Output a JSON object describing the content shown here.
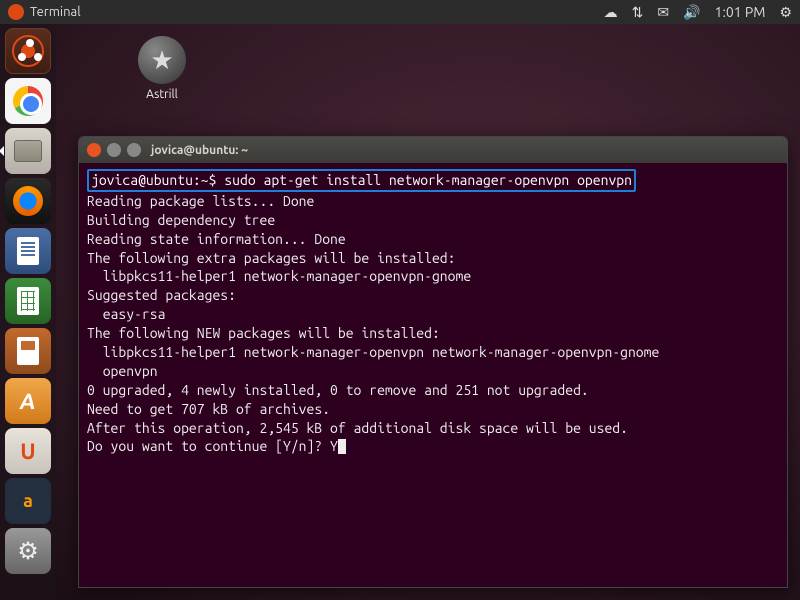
{
  "panel": {
    "app_name": "Terminal",
    "time": "1:01 PM"
  },
  "desktop": {
    "astrill_label": "Astrill"
  },
  "terminal": {
    "title": "jovica@ubuntu: ~",
    "prompt": "jovica@ubuntu:~$",
    "command": "sudo apt-get install network-manager-openvpn openvpn",
    "lines": [
      "Reading package lists... Done",
      "Building dependency tree",
      "Reading state information... Done",
      "The following extra packages will be installed:",
      "  libpkcs11-helper1 network-manager-openvpn-gnome",
      "Suggested packages:",
      "  easy-rsa",
      "The following NEW packages will be installed:",
      "  libpkcs11-helper1 network-manager-openvpn network-manager-openvpn-gnome",
      "  openvpn",
      "0 upgraded, 4 newly installed, 0 to remove and 251 not upgraded.",
      "Need to get 707 kB of archives.",
      "After this operation, 2,545 kB of additional disk space will be used.",
      "Do you want to continue [Y/n]? Y"
    ]
  }
}
